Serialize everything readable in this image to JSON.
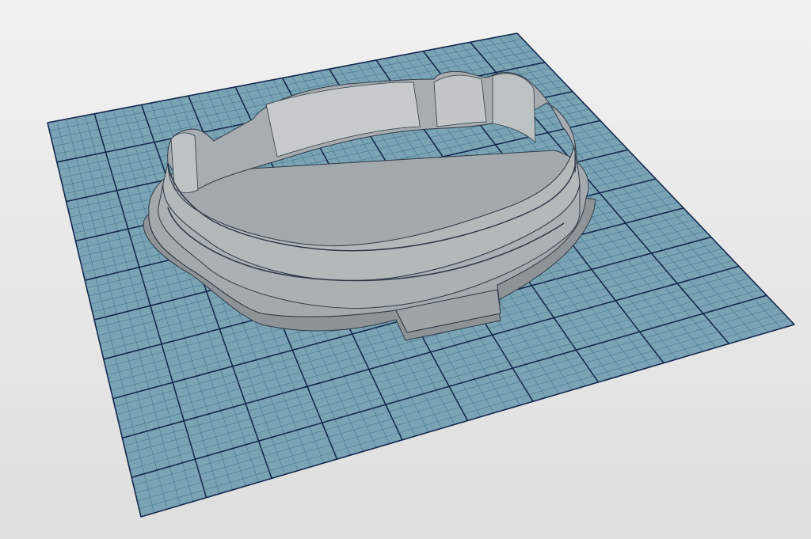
{
  "viewport": {
    "background": "#e6e6e6",
    "label": ""
  },
  "plane": {
    "color": "#7aa4b4",
    "major_grid_color": "#14284e",
    "minor_grid_color": "#43738f",
    "major_divisions": 10,
    "minor_per_major": 5
  },
  "model": {
    "name": "cookie-cutter",
    "color": "#a9aeb1",
    "shade_color": "#858b8e",
    "edge_color": "#2f3a48"
  }
}
